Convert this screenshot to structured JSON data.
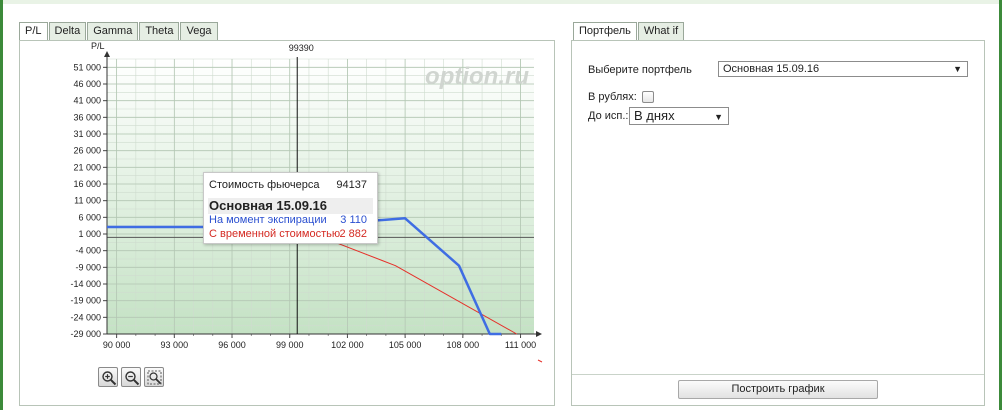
{
  "left_tabs": [
    "P/L",
    "Delta",
    "Gamma",
    "Theta",
    "Vega"
  ],
  "right_tabs": [
    "Портфель",
    "What if"
  ],
  "watermark": "option.ru",
  "tooltip": {
    "futures_label": "Стоимость фьючерса",
    "futures_value": "94137",
    "portfolio_title": "Основная 15.09.16",
    "expiry_label": "На момент экспирации",
    "expiry_value": "3 110",
    "timevalue_label": "С временной стоимостью",
    "timevalue_value": "2 882"
  },
  "zoom_icons": [
    "zoom-in-icon",
    "zoom-out-icon",
    "zoom-reset-icon"
  ],
  "form": {
    "portfolio_label": "Выберите портфель",
    "portfolio_value": "Основная 15.09.16",
    "rubles_label": "В рублях:",
    "rubles_checked": false,
    "expiry_label": "До исп.:",
    "expiry_value": "В днях",
    "build_button": "Построить график"
  },
  "colors": {
    "tab_active_accent": "#3c8a3a",
    "expiry_series": "#3f6de3",
    "timevalue_series": "#e6302a"
  },
  "chart_data": {
    "type": "line",
    "ylabel": "P/L",
    "x_ticks": [
      "90 000",
      "93 000",
      "96 000",
      "99 000",
      "102 000",
      "105 000",
      "108 000",
      "111 000"
    ],
    "x_tick_values": [
      90000,
      93000,
      96000,
      99000,
      102000,
      105000,
      108000,
      111000
    ],
    "y_ticks": [
      "51 000",
      "46 000",
      "41 000",
      "36 000",
      "31 000",
      "26 000",
      "21 000",
      "16 000",
      "11 000",
      "6 000",
      "1 000",
      "-4 000",
      "-9 000",
      "-14 000",
      "-19 000",
      "-24 000",
      "-29 000"
    ],
    "y_tick_values": [
      51000,
      46000,
      41000,
      36000,
      31000,
      26000,
      21000,
      16000,
      11000,
      6000,
      1000,
      -4000,
      -9000,
      -14000,
      -19000,
      -24000,
      -29000
    ],
    "xlim": [
      89500,
      111700
    ],
    "ylim": [
      -29000,
      53500
    ],
    "current_price_label": "99390",
    "current_price": 99390,
    "grid": true,
    "series": [
      {
        "name": "На момент экспирации",
        "color": "#3f6de3",
        "width": 2.5,
        "x": [
          89500,
          99000,
          105000,
          107800,
          109400,
          110000
        ],
        "y": [
          3100,
          3100,
          5700,
          -8500,
          -29000,
          -29000
        ]
      },
      {
        "name": "С временной стоимостью",
        "color": "#e6302a",
        "width": 1,
        "x": [
          89500,
          96000,
          99400,
          104500,
          110800
        ],
        "y": [
          3100,
          3000,
          2900,
          -8500,
          -29000
        ]
      }
    ]
  }
}
